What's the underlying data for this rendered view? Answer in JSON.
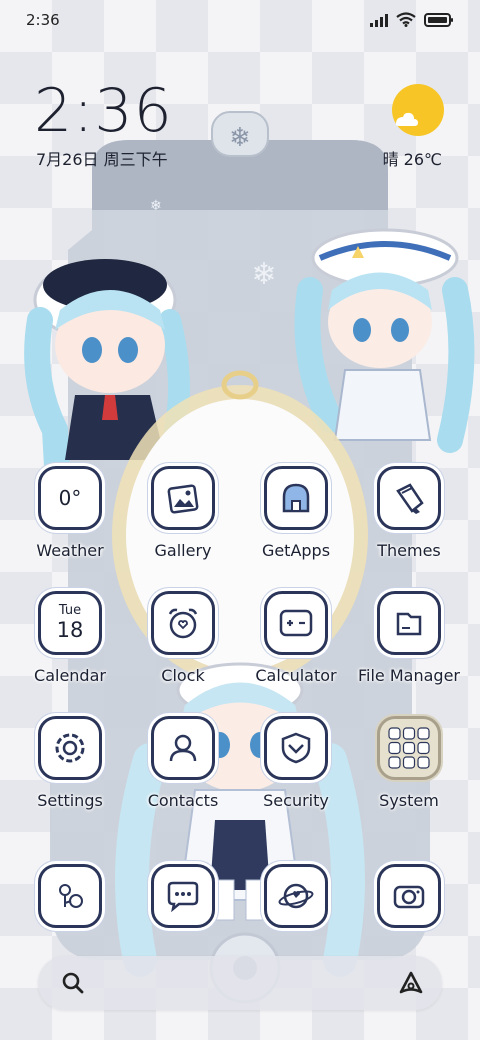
{
  "status_bar": {
    "time": "2:36",
    "icons": [
      "signal-icon",
      "wifi-icon",
      "battery-icon"
    ]
  },
  "clock_widget": {
    "time": "2:36",
    "date": "7月26日 周三下午"
  },
  "weather_widget": {
    "condition_icon": "sun-cloud-icon",
    "text": "晴 26℃"
  },
  "apps": [
    {
      "label": "Weather",
      "icon": "weather-icon",
      "text": "0°"
    },
    {
      "label": "Gallery",
      "icon": "gallery-icon"
    },
    {
      "label": "GetApps",
      "icon": "getapps-icon"
    },
    {
      "label": "Themes",
      "icon": "themes-icon"
    },
    {
      "label": "Calendar",
      "icon": "calendar-icon",
      "day": "Tue",
      "date": "18"
    },
    {
      "label": "Clock",
      "icon": "clock-icon"
    },
    {
      "label": "Calculator",
      "icon": "calculator-icon"
    },
    {
      "label": "File Manager",
      "icon": "file-manager-icon"
    },
    {
      "label": "Settings",
      "icon": "settings-icon"
    },
    {
      "label": "Contacts",
      "icon": "contacts-icon"
    },
    {
      "label": "Security",
      "icon": "security-icon"
    },
    {
      "label": "System",
      "icon": "system-folder-icon"
    }
  ],
  "dock": [
    {
      "icon": "phone-icon"
    },
    {
      "icon": "messages-icon"
    },
    {
      "icon": "browser-icon"
    },
    {
      "icon": "camera-icon"
    }
  ],
  "search": {
    "left_icon": "search-icon",
    "right_icon": "assistant-icon"
  },
  "colors": {
    "accent_outline": "#2a3559",
    "sun": "#f7c626",
    "label_text": "#1c2233"
  }
}
